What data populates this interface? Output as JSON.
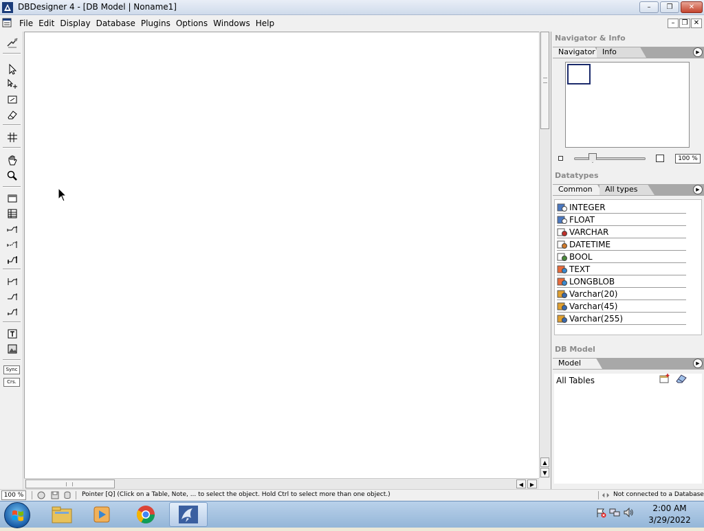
{
  "window": {
    "title": "DBDesigner 4 - [DB Model | Noname1]",
    "controls": {
      "minimize": "–",
      "maximize": "❐",
      "close": "✕"
    }
  },
  "menubar": {
    "items": [
      "File",
      "Edit",
      "Display",
      "Database",
      "Plugins",
      "Options",
      "Windows",
      "Help"
    ],
    "mdi_controls": {
      "minimize": "–",
      "restore": "❐",
      "close": "✕"
    }
  },
  "toolbar": {
    "sync_label": "Sync",
    "crs_label": "Crs."
  },
  "navigator": {
    "section_title": "Navigator & Info",
    "tabs": [
      "Navigator",
      "Info"
    ],
    "zoom": "100 %"
  },
  "datatypes": {
    "section_title": "Datatypes",
    "tabs": [
      "Common",
      "All types"
    ],
    "items": [
      {
        "label": "INTEGER",
        "icon": "numeric-type-icon"
      },
      {
        "label": "FLOAT",
        "icon": "numeric-type-icon"
      },
      {
        "label": "VARCHAR",
        "icon": "string-type-icon"
      },
      {
        "label": "DATETIME",
        "icon": "datetime-type-icon"
      },
      {
        "label": "BOOL",
        "icon": "bool-type-icon"
      },
      {
        "label": "TEXT",
        "icon": "text-type-icon"
      },
      {
        "label": "LONGBLOB",
        "icon": "blob-type-icon"
      },
      {
        "label": "Varchar(20)",
        "icon": "user-type-icon"
      },
      {
        "label": "Varchar(45)",
        "icon": "user-type-icon"
      },
      {
        "label": "Varchar(255)",
        "icon": "user-type-icon"
      }
    ]
  },
  "dbmodel": {
    "section_title": "DB Model",
    "tabs": [
      "Model"
    ],
    "tree_root": "All Tables"
  },
  "statusbar": {
    "zoom": "100 %",
    "message": "Pointer [Q] (Click on a Table, Note, ... to select the object. Hold Ctrl to select more than one object.)",
    "connection": "Not connected to a Database"
  },
  "taskbar": {
    "time": "2:00 AM",
    "date": "3/29/2022"
  },
  "colors": {
    "canvas": "#ffffff",
    "panel": "#f0f0f0",
    "tabstrip": "#a8a8a8",
    "taskbar": "#b9d1ea"
  }
}
